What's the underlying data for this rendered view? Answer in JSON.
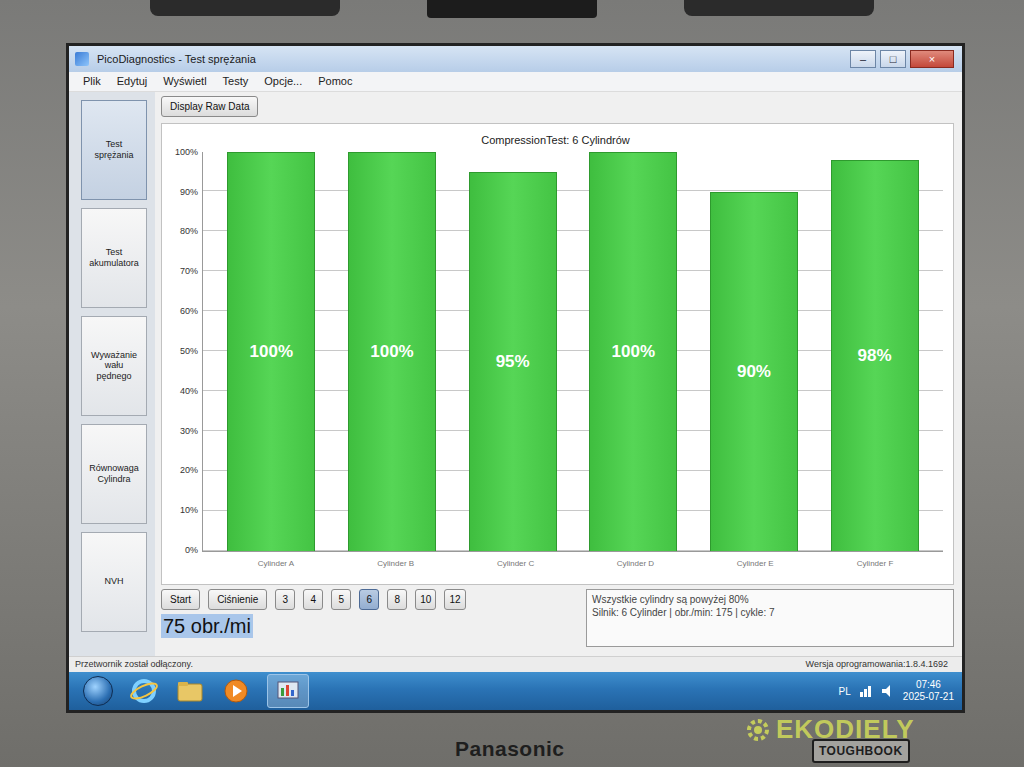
{
  "window": {
    "title": "PicoDiagnostics - Test sprężania",
    "controls": [
      "–",
      "□",
      "×"
    ]
  },
  "menu": [
    "Plik",
    "Edytuj",
    "Wyświetl",
    "Testy",
    "Opcje...",
    "Pomoc"
  ],
  "toolbar": {
    "button": "Display Raw Data"
  },
  "sidebar": {
    "items": [
      {
        "label": "Test sprężania",
        "selected": true
      },
      {
        "label": "Test akumulatora",
        "selected": false
      },
      {
        "label": "Wyważanie wału pędnego",
        "selected": false
      },
      {
        "label": "Równowaga Cylindra",
        "selected": false
      },
      {
        "label": "NVH",
        "selected": false
      }
    ]
  },
  "chart": {
    "title": "CompressionTest: 6 Cylindrów",
    "y_ticks": [
      "100%",
      "90%",
      "80%",
      "70%",
      "60%",
      "50%",
      "40%",
      "30%",
      "20%",
      "10%",
      "0%"
    ],
    "categories": [
      "Cylinder A",
      "Cylinder B",
      "Cylinder C",
      "Cylinder D",
      "Cylinder E",
      "Cylinder F"
    ],
    "values": [
      100,
      100,
      95,
      100,
      90,
      98
    ],
    "value_labels": [
      "100%",
      "100%",
      "95%",
      "100%",
      "90%",
      "98%"
    ]
  },
  "controls": {
    "buttons": [
      "Start",
      "Ciśnienie"
    ],
    "cylinder_counts": [
      {
        "label": "3",
        "selected": false
      },
      {
        "label": "4",
        "selected": false
      },
      {
        "label": "5",
        "selected": false
      },
      {
        "label": "6",
        "selected": true
      },
      {
        "label": "8",
        "selected": false
      },
      {
        "label": "10",
        "selected": false
      },
      {
        "label": "12",
        "selected": false
      }
    ]
  },
  "rpm_display": "75 obr./mi",
  "info": [
    "Wszystkie cylindry są powyżej 80%",
    "Silnik: 6 Cylinder | obr./min: 175 | cykle: 7"
  ],
  "status_bar": {
    "left": "Przetwornik został odłączony.",
    "right": "Wersja oprogramowania:1.8.4.1692"
  },
  "taskbar": {
    "language": "PL",
    "time": "07:46",
    "date": "2025-07-21"
  },
  "watermark": "EKODIELY",
  "device": {
    "brand": "Panasonic",
    "model": "TOUGHBOOK"
  }
}
